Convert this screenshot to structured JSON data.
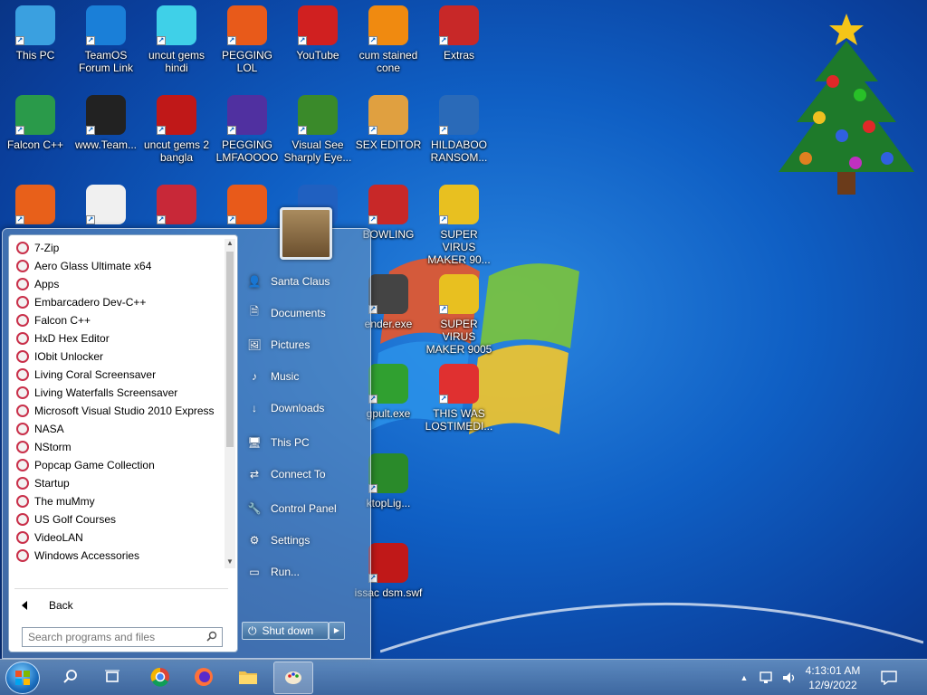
{
  "desktop": {
    "icons": [
      {
        "label": "This PC",
        "icon": "computer-icon",
        "color": "#3aa0e0"
      },
      {
        "label": "TeamOS Forum Link",
        "icon": "gear-icon",
        "color": "#1a7fd8"
      },
      {
        "label": "uncut gems hindi",
        "icon": "gem-icon",
        "color": "#3fd0e8"
      },
      {
        "label": "PEGGING LOL",
        "icon": "popcap-icon",
        "color": "#e85a1a"
      },
      {
        "label": "YouTube",
        "icon": "angry-bird-icon",
        "color": "#d02020"
      },
      {
        "label": "cum stained cone",
        "icon": "vlc-cone-icon",
        "color": "#f08a10"
      },
      {
        "label": "Extras",
        "icon": "folder-red-icon",
        "color": "#c82828"
      },
      {
        "label": "Falcon C++",
        "icon": "falcon-icon",
        "color": "#2a9a4a"
      },
      {
        "label": "www.Team...",
        "icon": "file-icon",
        "color": "#222222"
      },
      {
        "label": "uncut gems 2 bangla",
        "icon": "number-2-icon",
        "color": "#c01818"
      },
      {
        "label": "PEGGING LMFAOOOO",
        "icon": "orb-icon",
        "color": "#5030a0"
      },
      {
        "label": "Visual See Sharply Eye...",
        "icon": "csharp-icon",
        "color": "#3a8a2a"
      },
      {
        "label": "SEX EDITOR",
        "icon": "hxd-icon",
        "color": "#e0a040"
      },
      {
        "label": "HILDABOO RANSOM...",
        "icon": "script-icon",
        "color": "#2a6ab8"
      },
      {
        "label": "",
        "icon": "firefox-icon",
        "color": "#e8601a"
      },
      {
        "label": "",
        "icon": "pixel-art-icon",
        "color": "#f0f0f0"
      },
      {
        "label": "",
        "icon": "gem-heart-icon",
        "color": "#c82838"
      },
      {
        "label": "",
        "icon": "popcap-icon",
        "color": "#e85a1a"
      },
      {
        "label": "",
        "icon": "vs-icon",
        "color": "#2060c0"
      },
      {
        "label": "BOWLING",
        "icon": "folder-red-icon",
        "color": "#c82828"
      },
      {
        "label": "SUPER VIRUS MAKER 90...",
        "icon": "toolbox-icon",
        "color": "#e8c020"
      },
      {
        "label": "ender.exe",
        "icon": "clapper-icon",
        "color": "#444444"
      },
      {
        "label": "SUPER VIRUS MAKER 9005",
        "icon": "toolbox-icon",
        "color": "#e8c020"
      },
      {
        "label": "gpult.exe",
        "icon": "frog-icon",
        "color": "#30a030"
      },
      {
        "label": "THIS WAS LOSTIMEDI...",
        "icon": "colors-icon",
        "color": "#e03030"
      },
      {
        "label": "ktopLig...",
        "icon": "xmas-tree-icon",
        "color": "#2a8a2a"
      },
      {
        "label": "issac dsm.swf",
        "icon": "swf-icon",
        "color": "#c01818"
      }
    ]
  },
  "start_menu": {
    "programs": [
      "7-Zip",
      "Aero Glass Ultimate x64",
      "Apps",
      "Embarcadero Dev-C++",
      "Falcon C++",
      "HxD Hex Editor",
      "IObit Unlocker",
      "Living Coral Screensaver",
      "Living Waterfalls Screensaver",
      "Microsoft Visual Studio 2010 Express",
      "NASA",
      "NStorm",
      "Popcap Game Collection",
      "Startup",
      "The muMmy",
      "US Golf Courses",
      "VideoLAN",
      "Windows Accessories"
    ],
    "back_label": "Back",
    "search_placeholder": "Search programs and files",
    "places": [
      {
        "label": "Santa Claus",
        "icon": "user-icon"
      },
      {
        "label": "Documents",
        "icon": "documents-icon"
      },
      {
        "label": "Pictures",
        "icon": "pictures-icon"
      },
      {
        "label": "Music",
        "icon": "music-icon"
      },
      {
        "label": "Downloads",
        "icon": "download-icon"
      },
      {
        "label": "This PC",
        "icon": "monitor-icon"
      },
      {
        "label": "Connect To",
        "icon": "connect-icon"
      },
      {
        "label": "Control Panel",
        "icon": "wrench-icon"
      },
      {
        "label": "Settings",
        "icon": "gear-icon"
      },
      {
        "label": "Run...",
        "icon": "run-icon"
      }
    ],
    "shutdown_label": "Shut down"
  },
  "taskbar": {
    "buttons": [
      {
        "name": "search",
        "icon": "search-icon"
      },
      {
        "name": "task-view",
        "icon": "task-view-icon"
      },
      {
        "name": "chrome",
        "icon": "chrome-icon"
      },
      {
        "name": "firefox",
        "icon": "firefox-icon"
      },
      {
        "name": "file-explorer",
        "icon": "folder-icon"
      },
      {
        "name": "paint",
        "icon": "paint-icon"
      }
    ],
    "time": "4:13:01 AM",
    "date": "12/9/2022"
  }
}
